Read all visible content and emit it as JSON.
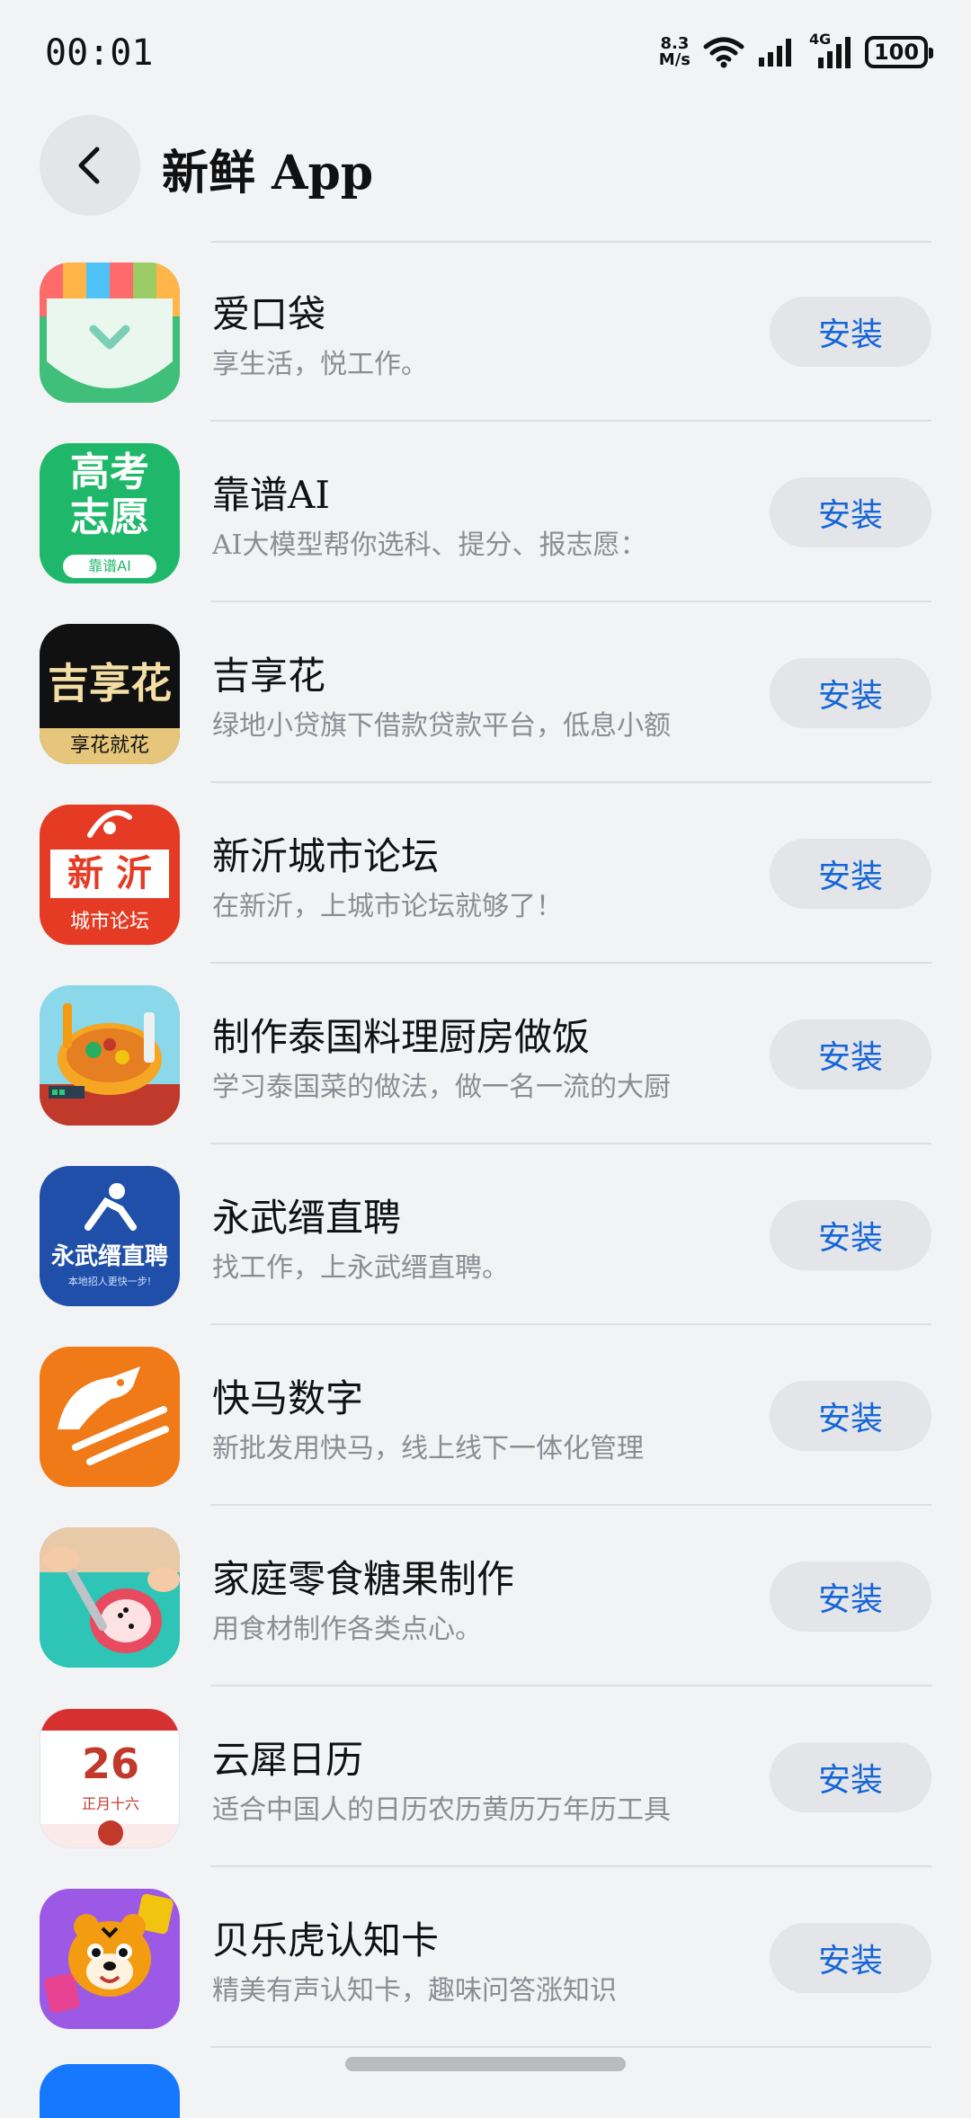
{
  "status": {
    "time": "00:01",
    "speed_value": "8.3",
    "speed_unit": "M/s",
    "network": "4G",
    "battery": "100"
  },
  "header": {
    "title": "新鲜 App"
  },
  "install_label": "安装",
  "apps": [
    {
      "name": "爱口袋",
      "desc": "享生活，悦工作。",
      "icon": "pocket-icon",
      "icon_bg": "#3fbf7a"
    },
    {
      "name": "靠谱AI",
      "desc": "AI大模型帮你选科、提分、报志愿：",
      "icon": "gaokao-icon",
      "icon_bg": "#1fb86a",
      "icon_text": [
        "高考",
        "志愿"
      ],
      "icon_sub": "靠谱AI"
    },
    {
      "name": "吉享花",
      "desc": "绿地小贷旗下借款贷款平台，低息小额",
      "icon": "jixianghua-icon",
      "icon_bg": "#111111",
      "icon_text": [
        "吉享花"
      ],
      "icon_sub": "享花就花"
    },
    {
      "name": "新沂城市论坛",
      "desc": "在新沂，上城市论坛就够了！",
      "icon": "xinyi-forum-icon",
      "icon_bg": "#e53b24",
      "icon_text": [
        "新 沂"
      ],
      "icon_sub": "城市论坛"
    },
    {
      "name": "制作泰国料理厨房做饭",
      "desc": "学习泰国菜的做法，做一名一流的大厨",
      "icon": "thai-kitchen-icon",
      "icon_bg": "#7fd3e8"
    },
    {
      "name": "永武缙直聘",
      "desc": "找工作，上永武缙直聘。",
      "icon": "zhipin-icon",
      "icon_bg": "#1f4fa8",
      "icon_text": [
        "永武缙直聘"
      ],
      "icon_sub": "本地招人更快一步!"
    },
    {
      "name": "快马数字",
      "desc": "新批发用快马，线上线下一体化管理",
      "icon": "horse-icon",
      "icon_bg": "#f07a18"
    },
    {
      "name": "家庭零食糖果制作",
      "desc": "用食材制作各类点心。",
      "icon": "candy-making-icon",
      "icon_bg": "#2ec4b6"
    },
    {
      "name": "云犀日历",
      "desc": "适合中国人的日历农历黄历万年历工具",
      "icon": "calendar-icon",
      "icon_bg": "#ffffff",
      "icon_text": [
        "26"
      ],
      "icon_sub": "正月十六"
    },
    {
      "name": "贝乐虎认知卡",
      "desc": "精美有声认知卡，趣味问答涨知识",
      "icon": "tiger-icon",
      "icon_bg": "#9b59e6"
    }
  ]
}
